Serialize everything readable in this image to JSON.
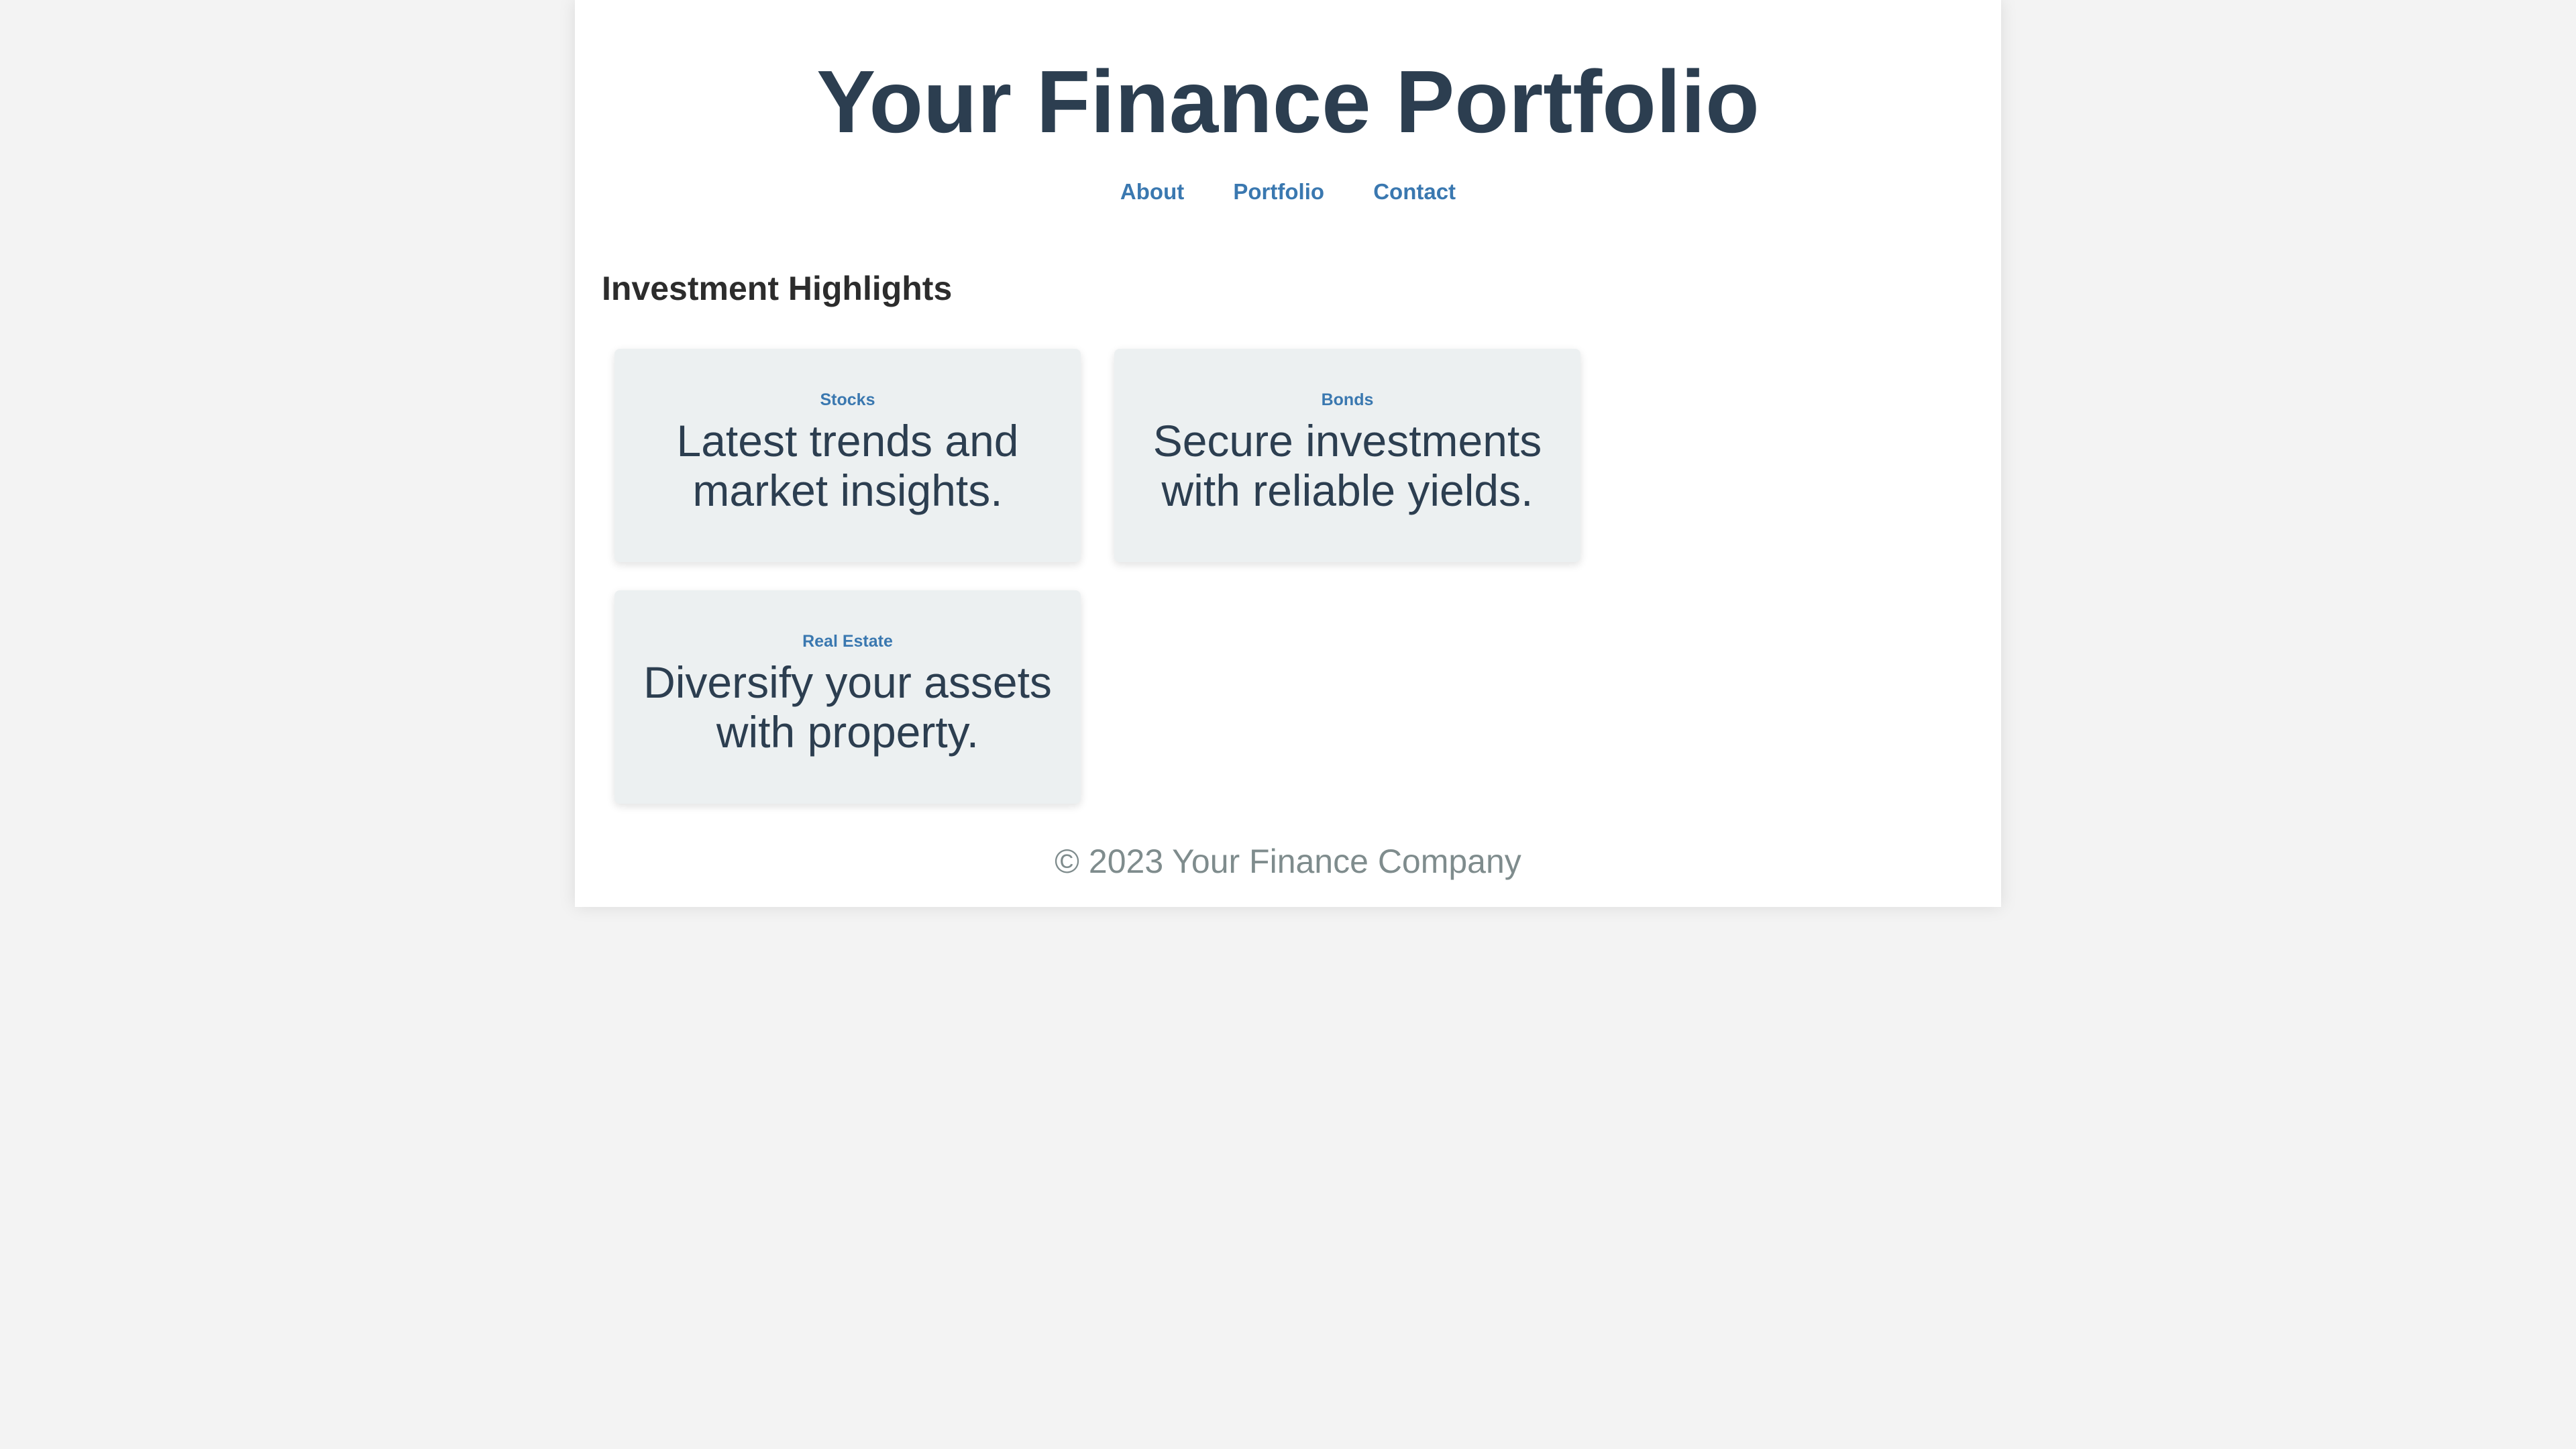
{
  "header": {
    "title": "Your Finance Portfolio",
    "nav": [
      {
        "label": "About"
      },
      {
        "label": "Portfolio"
      },
      {
        "label": "Contact"
      }
    ]
  },
  "main": {
    "section_title": "Investment Highlights",
    "cards": [
      {
        "label": "Stocks",
        "text": "Latest trends and market insights."
      },
      {
        "label": "Bonds",
        "text": "Secure investments with reliable yields."
      },
      {
        "label": "Real Estate",
        "text": "Diversify your assets with property."
      }
    ]
  },
  "footer": {
    "text": "© 2023 Your Finance Company"
  },
  "colors": {
    "background": "#f3f3f3",
    "page": "#ffffff",
    "title": "#2c3e50",
    "link": "#3a78b0",
    "card_background": "#ecf0f1",
    "footer_text": "#7f8c8d"
  }
}
